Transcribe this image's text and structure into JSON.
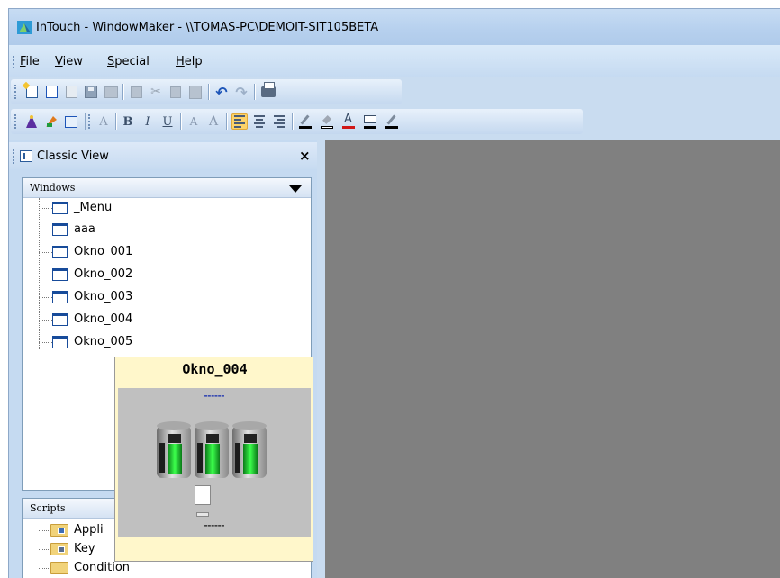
{
  "window": {
    "title": "InTouch - WindowMaker - \\\\TOMAS-PC\\DEMOIT-SIT105BETA"
  },
  "menu": {
    "items": [
      {
        "hotkey": "F",
        "rest": "ile"
      },
      {
        "hotkey": "V",
        "rest": "iew"
      },
      {
        "hotkey": "S",
        "rest": "pecial"
      },
      {
        "hotkey": "H",
        "rest": "elp"
      }
    ]
  },
  "toolbar_format": {
    "bold": "B",
    "italic": "I",
    "underline": "U",
    "font_fill_letter": "A",
    "font_color": "#d01818",
    "line_color": "#000000"
  },
  "classic_view": {
    "title": "Classic View",
    "close": "×",
    "windows_section": {
      "title": "Windows",
      "items": [
        "_Menu",
        "aaa",
        "Okno_001",
        "Okno_002",
        "Okno_003",
        "Okno_004",
        "Okno_005"
      ]
    },
    "scripts_section": {
      "title": "Scripts",
      "items": [
        "Appli",
        "Key",
        "Condition"
      ]
    }
  },
  "preview": {
    "window_name": "Okno_004"
  },
  "colors": {
    "workspace": "#808080",
    "tooltip_bg": "#fff7cb",
    "toolbar_active": "#fcd36a"
  }
}
